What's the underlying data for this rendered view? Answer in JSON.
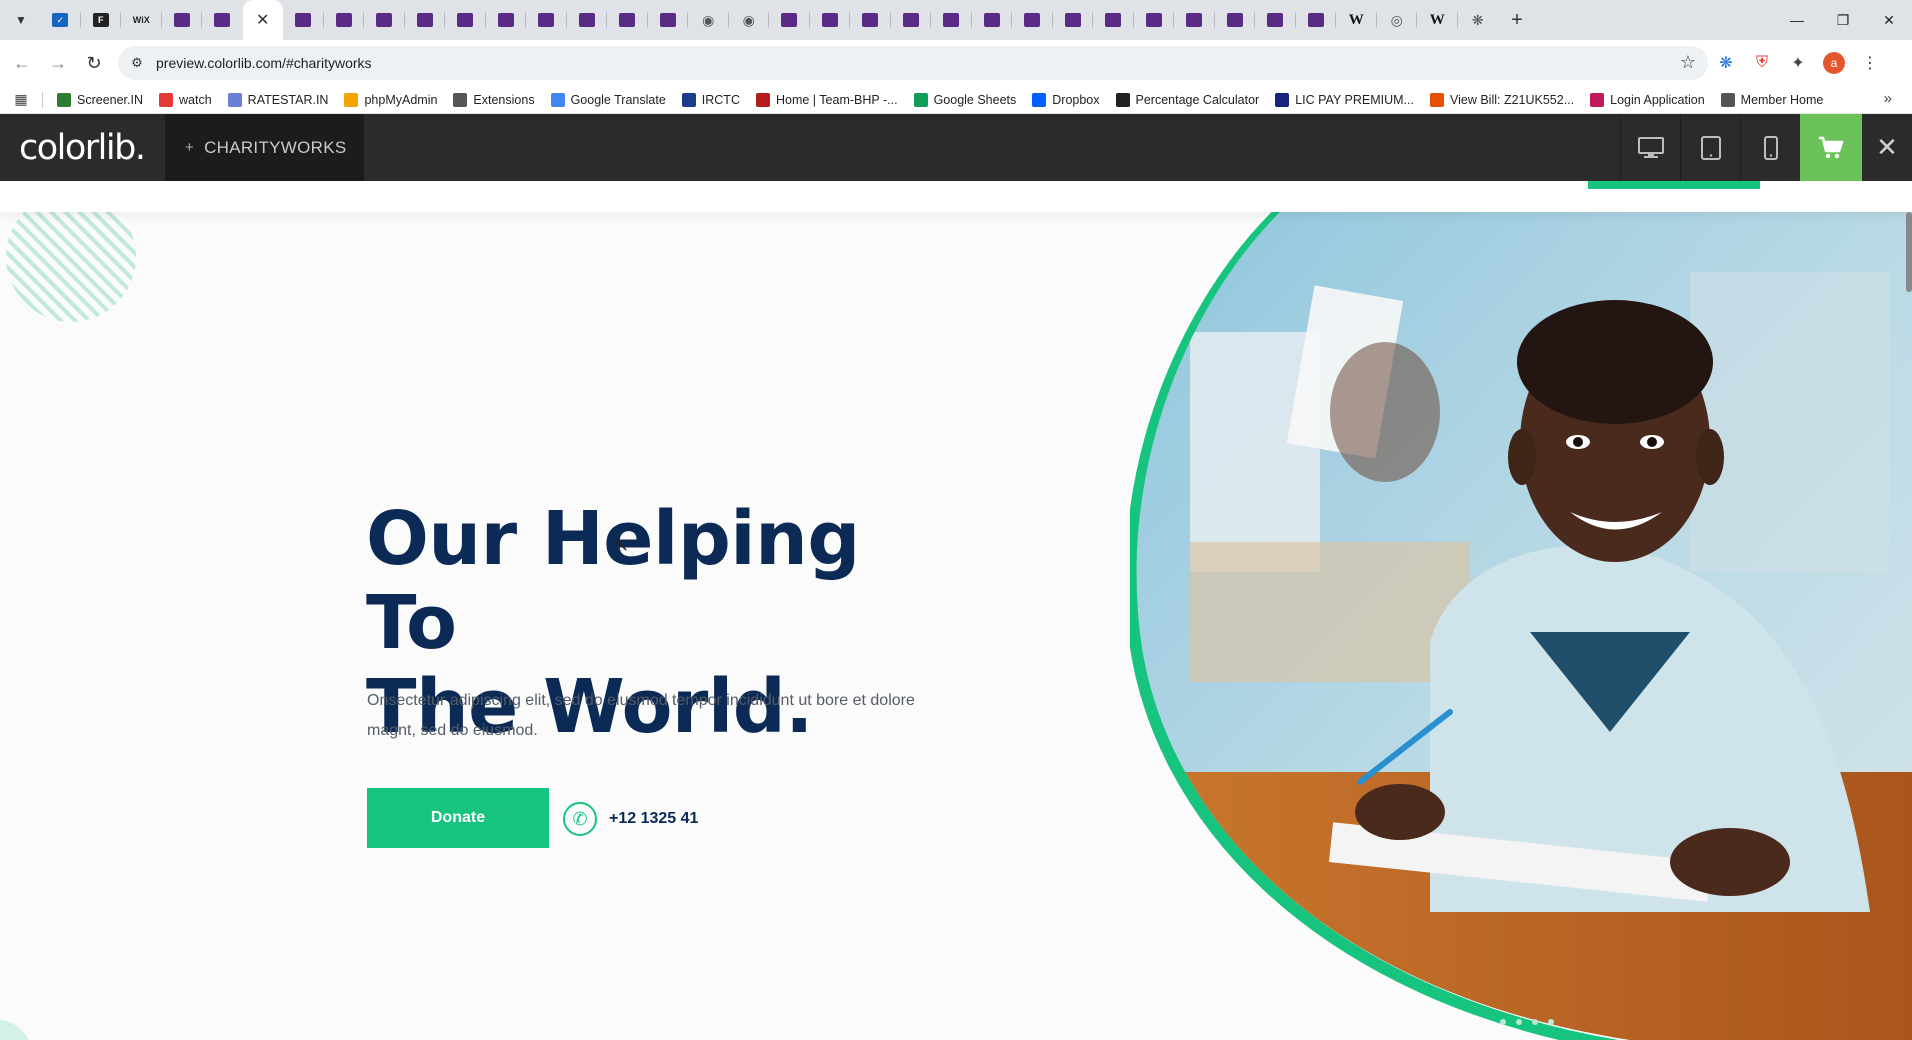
{
  "browser": {
    "tab_count_note": "",
    "url": "preview.colorlib.com/#charityworks",
    "bookmarks": [
      {
        "label": "Screener.IN",
        "color": "#2e7d32",
        "icon": "bar-chart-icon"
      },
      {
        "label": "watch",
        "color": "#e53935",
        "icon": "youtube-icon"
      },
      {
        "label": "RATESTAR.IN",
        "color": "#6a7fd6",
        "icon": "star-icon"
      },
      {
        "label": "phpMyAdmin",
        "color": "#f4a300",
        "icon": "php-icon"
      },
      {
        "label": "Extensions",
        "color": "#555555",
        "icon": "puzzle-icon"
      },
      {
        "label": "Google Translate",
        "color": "#4285f4",
        "icon": "translate-icon"
      },
      {
        "label": "IRCTC",
        "color": "#1a3e8c",
        "icon": "train-icon"
      },
      {
        "label": "Home | Team-BHP -...",
        "color": "#b71c1c",
        "icon": "team-bhp-icon"
      },
      {
        "label": "Google Sheets",
        "color": "#0f9d58",
        "icon": "sheets-icon"
      },
      {
        "label": "Dropbox",
        "color": "#0061ff",
        "icon": "dropbox-icon"
      },
      {
        "label": "Percentage Calculator",
        "color": "#222222",
        "icon": "percent-icon"
      },
      {
        "label": "LIC PAY PREMIUM...",
        "color": "#1a237e",
        "icon": "lic-icon"
      },
      {
        "label": "View Bill: Z21UK552...",
        "color": "#e65100",
        "icon": "bill-icon"
      },
      {
        "label": "Login Application",
        "color": "#c2185b",
        "icon": "login-icon"
      },
      {
        "label": "Member Home",
        "color": "#555555",
        "icon": "globe-icon"
      }
    ]
  },
  "colorlib": {
    "logo": "colorlib.",
    "theme_name": "CHARITYWORKS",
    "accent": "#6ac259"
  },
  "hero": {
    "title_line1": "Our Helping To",
    "title_line2": "The World.",
    "description": "Onsectetur adipiscing elit, sed do eiusmod tempor incididunt ut bore et dolore magnt, sed do eiusmod.",
    "donate_label": "Donate",
    "phone": "+12 1325 41",
    "accent": "#17c47f",
    "title_color": "#0b2a55"
  }
}
